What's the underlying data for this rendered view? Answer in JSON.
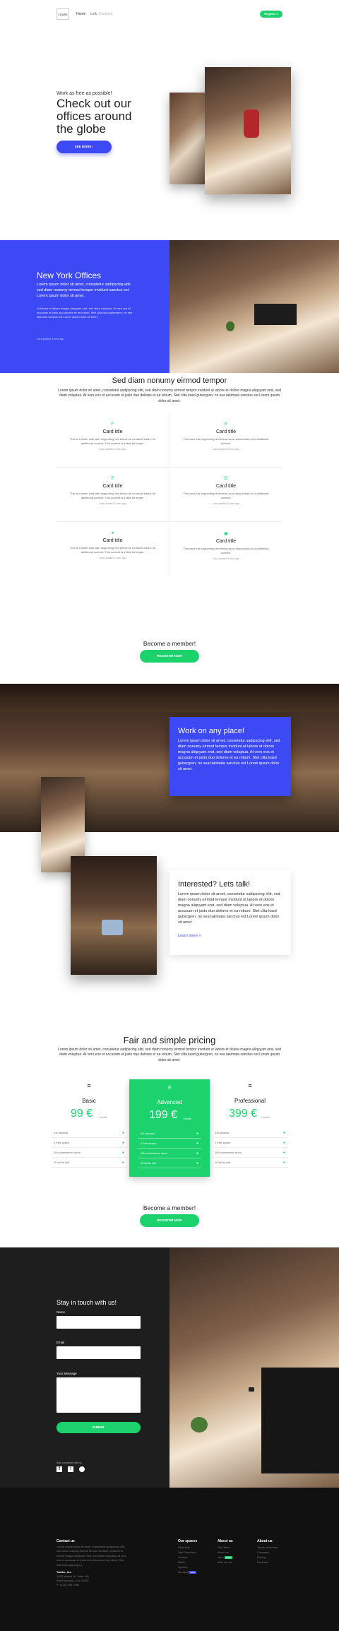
{
  "nav": {
    "logo": "COWRK",
    "links": [
      "Home",
      "Link",
      "Disabled"
    ],
    "register": "Register"
  },
  "hero": {
    "kicker": "Work as free as possible!",
    "title": "Check out our offices around the globe",
    "button": "SEE MORE"
  },
  "ny": {
    "title": "New York Offices",
    "lead": "Lorem ipsum dolor sit amet, consetetur sadipscing elitr, sed diam nonumy eirmod tempor invidunt ut labore et dolore magna aliquyam erat, sed diam voluptua. At vero eos et accusam et justo duo dolores et ea rebum. Stet clita kasd gubergren, no sea takimata sanctus est Lorem ipsum dolor sit amet.",
    "lead_short": "Lorem ipsum dolor sit amet, consetetur sadipscing elitr, sed diam nonumy eirmod tempor invidunt sanctus est Lorem ipsum dolor sit amet.",
    "small": "Ut labore et dolore magna aliquyam erat, sed diam voluptua. At vero eos et accusam et justo duo dolores et ea rebum. Stet clita kasd gubergren, no sea takimata sanctus est Lorem ipsum dolor sit amet.",
    "updated": "Last updated 3 mins ago"
  },
  "features": {
    "title": "Sed diam nonumy eirmod tempor",
    "lead": "Lorem ipsum dolor sit amet, consetetur sadipscing elitr, sed diam nonumy eirmod tempor invidunt ut labore et dolore magna aliquyam erat, sed diam voluptua. At vero eos et accusam et justo duo dolores et ea rebum. Stet clita kasd gubergren, no sea takimata sanctus est Lorem ipsum dolor sit amet.",
    "cards": [
      {
        "icon": "F",
        "title": "Card title",
        "body": "This is a wider card with supporting text below as a natural lead-in to additional content. This content is a little bit longer.",
        "updated": "Last updated 3 mins ago"
      },
      {
        "icon": "E",
        "title": "Card title",
        "body": "This card has supporting text below as a natural lead-in to additional content.",
        "updated": "Last updated 3 mins ago"
      },
      {
        "icon": "F",
        "title": "Card title",
        "body": "This is a wider card with supporting text below as a natural lead-in to additional content. This content is a little bit longer.",
        "updated": "Last updated 3 mins ago"
      },
      {
        "icon": "D",
        "title": "Card title",
        "body": "This card has supporting text below as a natural lead-in to additional content.",
        "updated": "Last updated 3 mins ago"
      },
      {
        "icon": "●",
        "title": "Card title",
        "body": "This is a wider card with supporting text below as a natural lead-in to additional content. This content is a little bit longer.",
        "updated": "Last updated 3 mins ago"
      },
      {
        "icon": "▣",
        "title": "Card title",
        "body": "This card has supporting text below as a natural lead-in to additional content.",
        "updated": "Last updated 3 mins ago"
      }
    ]
  },
  "member1": {
    "title": "Become a member!",
    "button": "REGISTER NOW"
  },
  "anyplace": {
    "title": "Work on any place!",
    "body": "Lorem ipsum dolor sit amet, consetetur sadipscing elitr, sed diam nonumy eirmod tempor invidunt ut labore et dolore magna aliquyam erat, sed diam voluptua. At vero eos et accusam et justo duo dolores et ea rebum. Stet clita kasd gubergren, no sea takimata sanctus est Lorem ipsum dolor sit amet."
  },
  "talk": {
    "title": "Interested? Lets talk!",
    "body": "Lorem ipsum dolor sit amet, consetetur sadipscing elitr, sed diam nonumy eirmod tempor invidunt ut labore et dolore magna aliquyam erat, sed diam voluptua. At vero eos et accusam et justo duo dolores et ea rebum. Stet clita kasd gubergren, no sea takimata sanctus est Lorem ipsum dolor sit amet.",
    "link": "Learn more »"
  },
  "pricing": {
    "title": "Fair and simple pricing",
    "lead": "Lorem ipsum dolor sit amet, consetetur sadipscing elitr, sed diam nonumy eirmod tempor invidunt ut labore et dolore magna aliquyam erat, sed diam voluptua. At vero eos et accusam et justo duo dolores et ea rebum. Stet clita kasd gubergren, no sea takimata sanctus est Lorem ipsum dolor sit amet.",
    "plans": [
      {
        "name": "Basic",
        "price": "99 €",
        "per": "/ month",
        "features": [
          "24h access",
          "1 free space",
          "10h conference room",
          "10 tla fw wifi"
        ]
      },
      {
        "name": "Advanced",
        "price": "199 €",
        "per": "/ month",
        "features": [
          "24h access",
          "1 free space",
          "10h conference room",
          "10 tla fw wifi"
        ]
      },
      {
        "name": "Professional",
        "price": "399 €",
        "per": "/ month",
        "features": [
          "24h access",
          "1 free space",
          "10h conference room",
          "10 tla fw wifi"
        ]
      }
    ]
  },
  "member2": {
    "title": "Become a member!",
    "button": "REGISTER NOW"
  },
  "contact": {
    "title": "Stay in touch with us!",
    "name_label": "Name",
    "email_label": "Email",
    "msg_label": "Your Message",
    "submit": "SUBMIT",
    "social_label": "Stay connected with us"
  },
  "footer": {
    "contact_h": "Contact us",
    "contact_body": "Lorem ipsum dolor sit amet, consetetur sadipscing elitr, sed diam nonumy eirmod tempor invidunt ut labore et dolore magna aliquyam erat, sed diam voluptua. At vero eos et accusam et justo duo dolores et ea rebum. Stet clita kasd gubergren.",
    "addr1": "Twitter, Inc.",
    "addr2": "1355 Market St, Suite 900",
    "addr3": "San Francisco, CA 94103",
    "addr4": "P: (123) 456-7890",
    "spaces_h": "Our spaces",
    "spaces": [
      "New York",
      "San Francisco",
      "London",
      "Berlin",
      "Sydney",
      "Mumbai"
    ],
    "mumbai_badge": "NEW",
    "about1_h": "About us",
    "about1": [
      "The Team",
      "About us",
      "Jobs",
      "Who we are"
    ],
    "jobs_badge": "NEW",
    "about2_h": "About us",
    "about2": [
      "Terms of service",
      "Company",
      "Pricing",
      "Products"
    ]
  },
  "colors": {
    "blue": "#3c49f5",
    "green": "#1cd26c",
    "dark": "#1e1e1e"
  }
}
